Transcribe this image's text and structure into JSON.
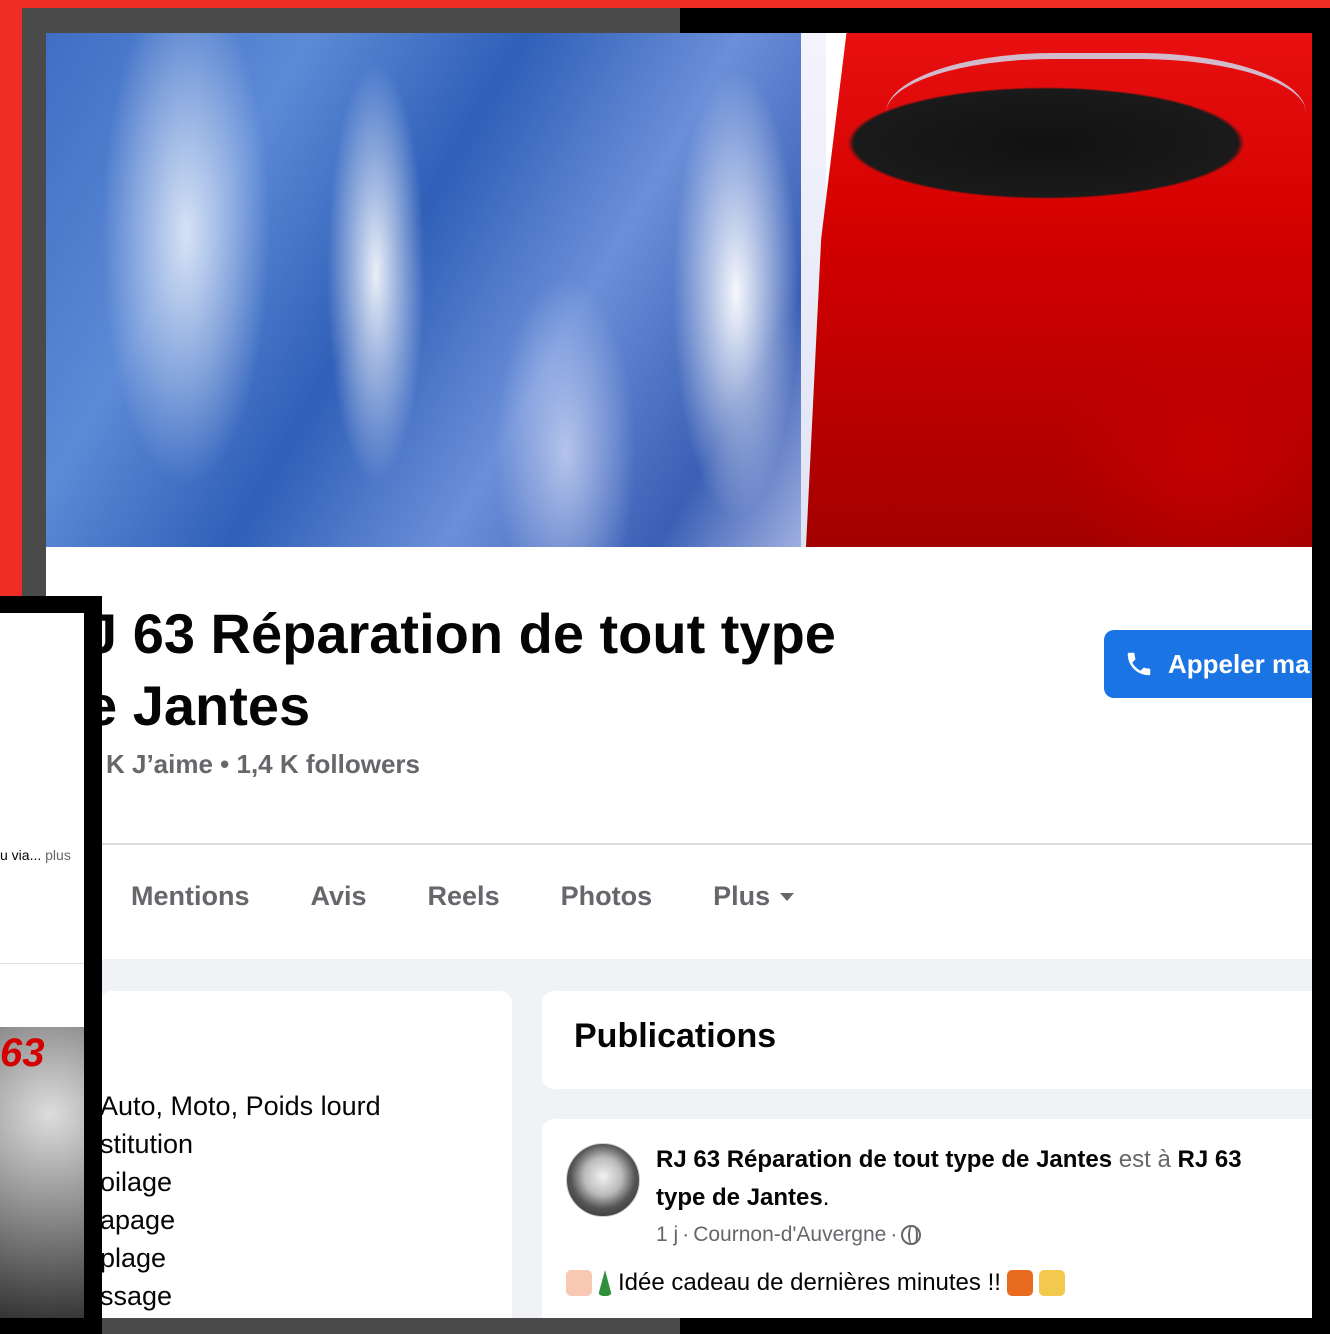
{
  "page": {
    "title_line1": "J 63 Réparation de tout type",
    "title_line2": "e Jantes",
    "stats": "K J’aime • 1,4 K followers",
    "call_button": "Appeler ma"
  },
  "tabs": [
    {
      "label": "Mentions"
    },
    {
      "label": "Avis"
    },
    {
      "label": "Reels"
    },
    {
      "label": "Photos"
    },
    {
      "label": "Plus"
    }
  ],
  "intro": {
    "lines": [
      "Auto, Moto, Poids lourd",
      "stitution",
      "oilage",
      "apage",
      "plage",
      "ssage"
    ]
  },
  "publications": {
    "header": "Publications",
    "post": {
      "author": "RJ 63 Réparation de tout type de Jantes",
      "connector": "est à",
      "place": "RJ 63",
      "place_line2": "type de Jantes",
      "meta_time": "1 j",
      "meta_sep": "·",
      "meta_location": "Cournon-d'Auvergne",
      "text": "Idée cadeau de dernières minutes !!"
    }
  },
  "overlay": {
    "snippet": "u via...",
    "more": "plus",
    "logo_text": "63"
  },
  "colors": {
    "accent": "#1b74e4",
    "background_frame": "#ee2e24"
  },
  "icons": [
    "phone-icon",
    "caret-down-icon",
    "globe-icon"
  ]
}
